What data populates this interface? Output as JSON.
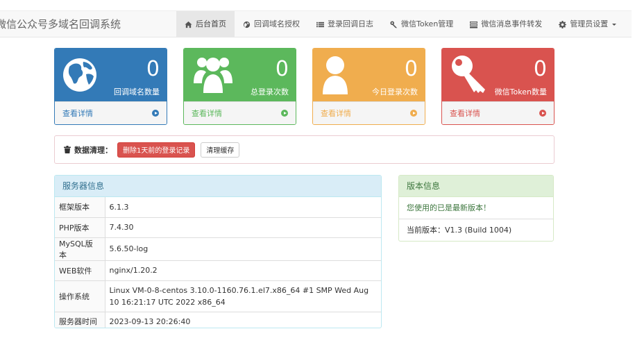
{
  "brand": "微信公众号多域名回调系统",
  "nav": [
    {
      "label": "后台首页",
      "icon": "home-icon"
    },
    {
      "label": "回调域名授权",
      "icon": "globe-icon"
    },
    {
      "label": "登录回调日志",
      "icon": "list-icon"
    },
    {
      "label": "微信Token管理",
      "icon": "key-icon"
    },
    {
      "label": "微信消息事件转发",
      "icon": "tasks-icon"
    },
    {
      "label": "管理员设置",
      "icon": "gear-icon"
    }
  ],
  "stats": [
    {
      "count": "0",
      "label": "回调域名数量",
      "link": "查看详情",
      "icon": "globe-icon",
      "color": "#337ab7"
    },
    {
      "count": "0",
      "label": "总登录次数",
      "link": "查看详情",
      "icon": "users-icon",
      "color": "#5cb85c"
    },
    {
      "count": "0",
      "label": "今日登录次数",
      "link": "查看详情",
      "icon": "user-icon",
      "color": "#f0ad4e"
    },
    {
      "count": "0",
      "label": "微信Token数量",
      "link": "查看详情",
      "icon": "key-icon",
      "color": "#d9534f"
    }
  ],
  "cleanup": {
    "title": "数据清理：",
    "delete_label": "删除1天前的登录记录",
    "cache_label": "清理缓存"
  },
  "server": {
    "title": "服务器信息",
    "rows": [
      {
        "k": "框架版本",
        "v": "6.1.3"
      },
      {
        "k": "PHP版本",
        "v": "7.4.30"
      },
      {
        "k": "MySQL版本",
        "v": "5.6.50-log"
      },
      {
        "k": "WEB软件",
        "v": "nginx/1.20.2"
      },
      {
        "k": "操作系统",
        "v": "Linux VM-0-8-centos 3.10.0-1160.76.1.el7.x86_64 #1 SMP Wed Aug 10 16:21:17 UTC 2022 x86_64"
      },
      {
        "k": "服务器时间",
        "v": "2023-09-13 20:26:40"
      }
    ]
  },
  "version": {
    "title": "版本信息",
    "status": "您使用的已是最新版本！",
    "current": "当前版本：V1.3 (Build 1004)"
  }
}
